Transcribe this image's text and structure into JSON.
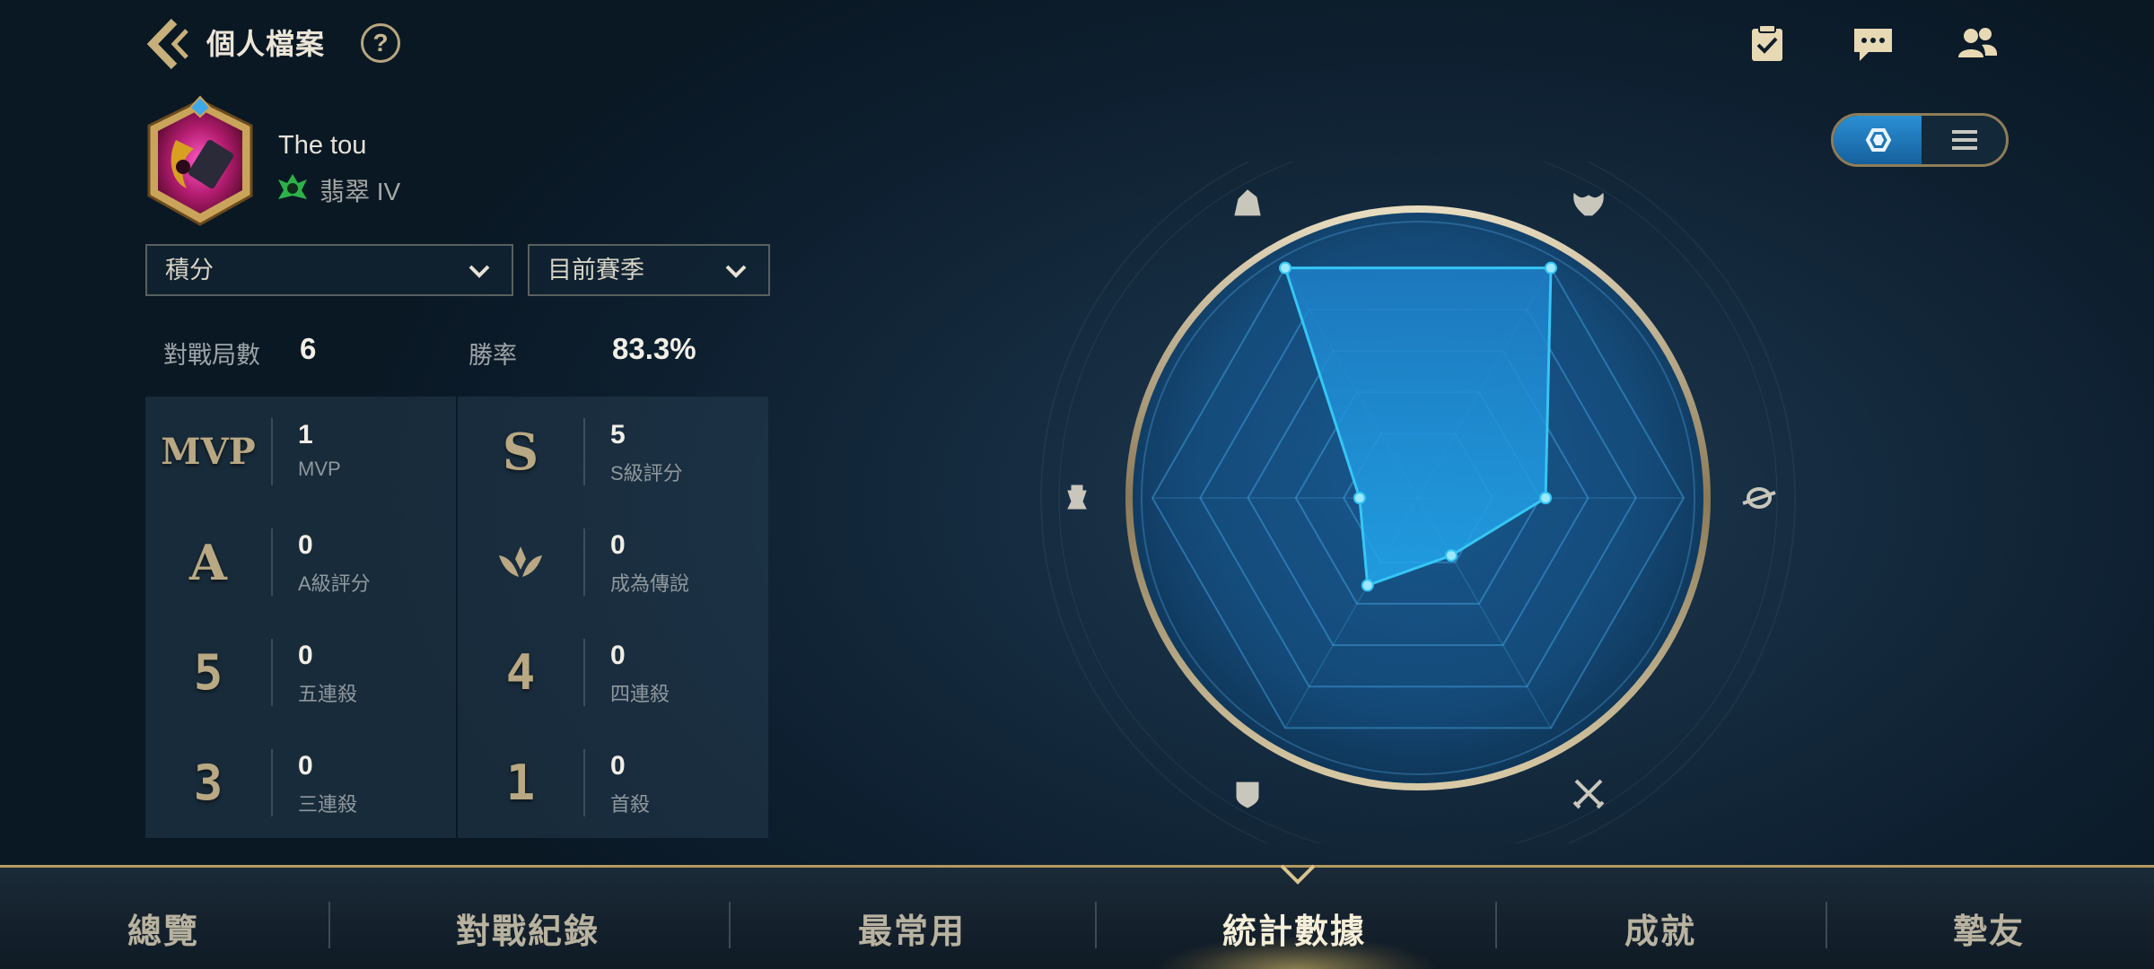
{
  "header": {
    "title": "個人檔案",
    "help": "?",
    "icons": [
      "checklist-icon",
      "chat-icon",
      "friends-icon"
    ]
  },
  "profile": {
    "name": "The tou",
    "rank": "翡翠 IV"
  },
  "filters": {
    "mode": "積分",
    "season": "目前賽季"
  },
  "summary": {
    "matches_label": "對戰局數",
    "matches_value": "6",
    "winrate_label": "勝率",
    "winrate_value": "83.3%"
  },
  "stats": [
    {
      "badge": "MVP",
      "value": "1",
      "label": "MVP"
    },
    {
      "badge": "S",
      "value": "5",
      "label": "S級評分"
    },
    {
      "badge": "A",
      "value": "0",
      "label": "A級評分"
    },
    {
      "badge": "legend-icon",
      "value": "0",
      "label": "成為傳說"
    },
    {
      "badge": "5",
      "value": "0",
      "label": "五連殺"
    },
    {
      "badge": "4",
      "value": "0",
      "label": "四連殺"
    },
    {
      "badge": "3",
      "value": "0",
      "label": "三連殺"
    },
    {
      "badge": "1",
      "value": "0",
      "label": "首殺"
    }
  ],
  "view_toggle": {
    "options": [
      "radar-view-icon",
      "list-view-icon"
    ],
    "selected": "radar-view-icon"
  },
  "radar": {
    "axes": [
      "warrior-icon",
      "horns-icon",
      "planet-icon",
      "crossed-swords-icon",
      "shield-icon",
      "chess-icon"
    ],
    "values": [
      1.0,
      1.0,
      0.48,
      0.25,
      0.38,
      0.22
    ],
    "color": "#35c6f4"
  },
  "nav": {
    "tabs": [
      "總覽",
      "對戰紀錄",
      "最常用",
      "統計數據",
      "成就",
      "摯友"
    ],
    "active": "統計數據"
  }
}
